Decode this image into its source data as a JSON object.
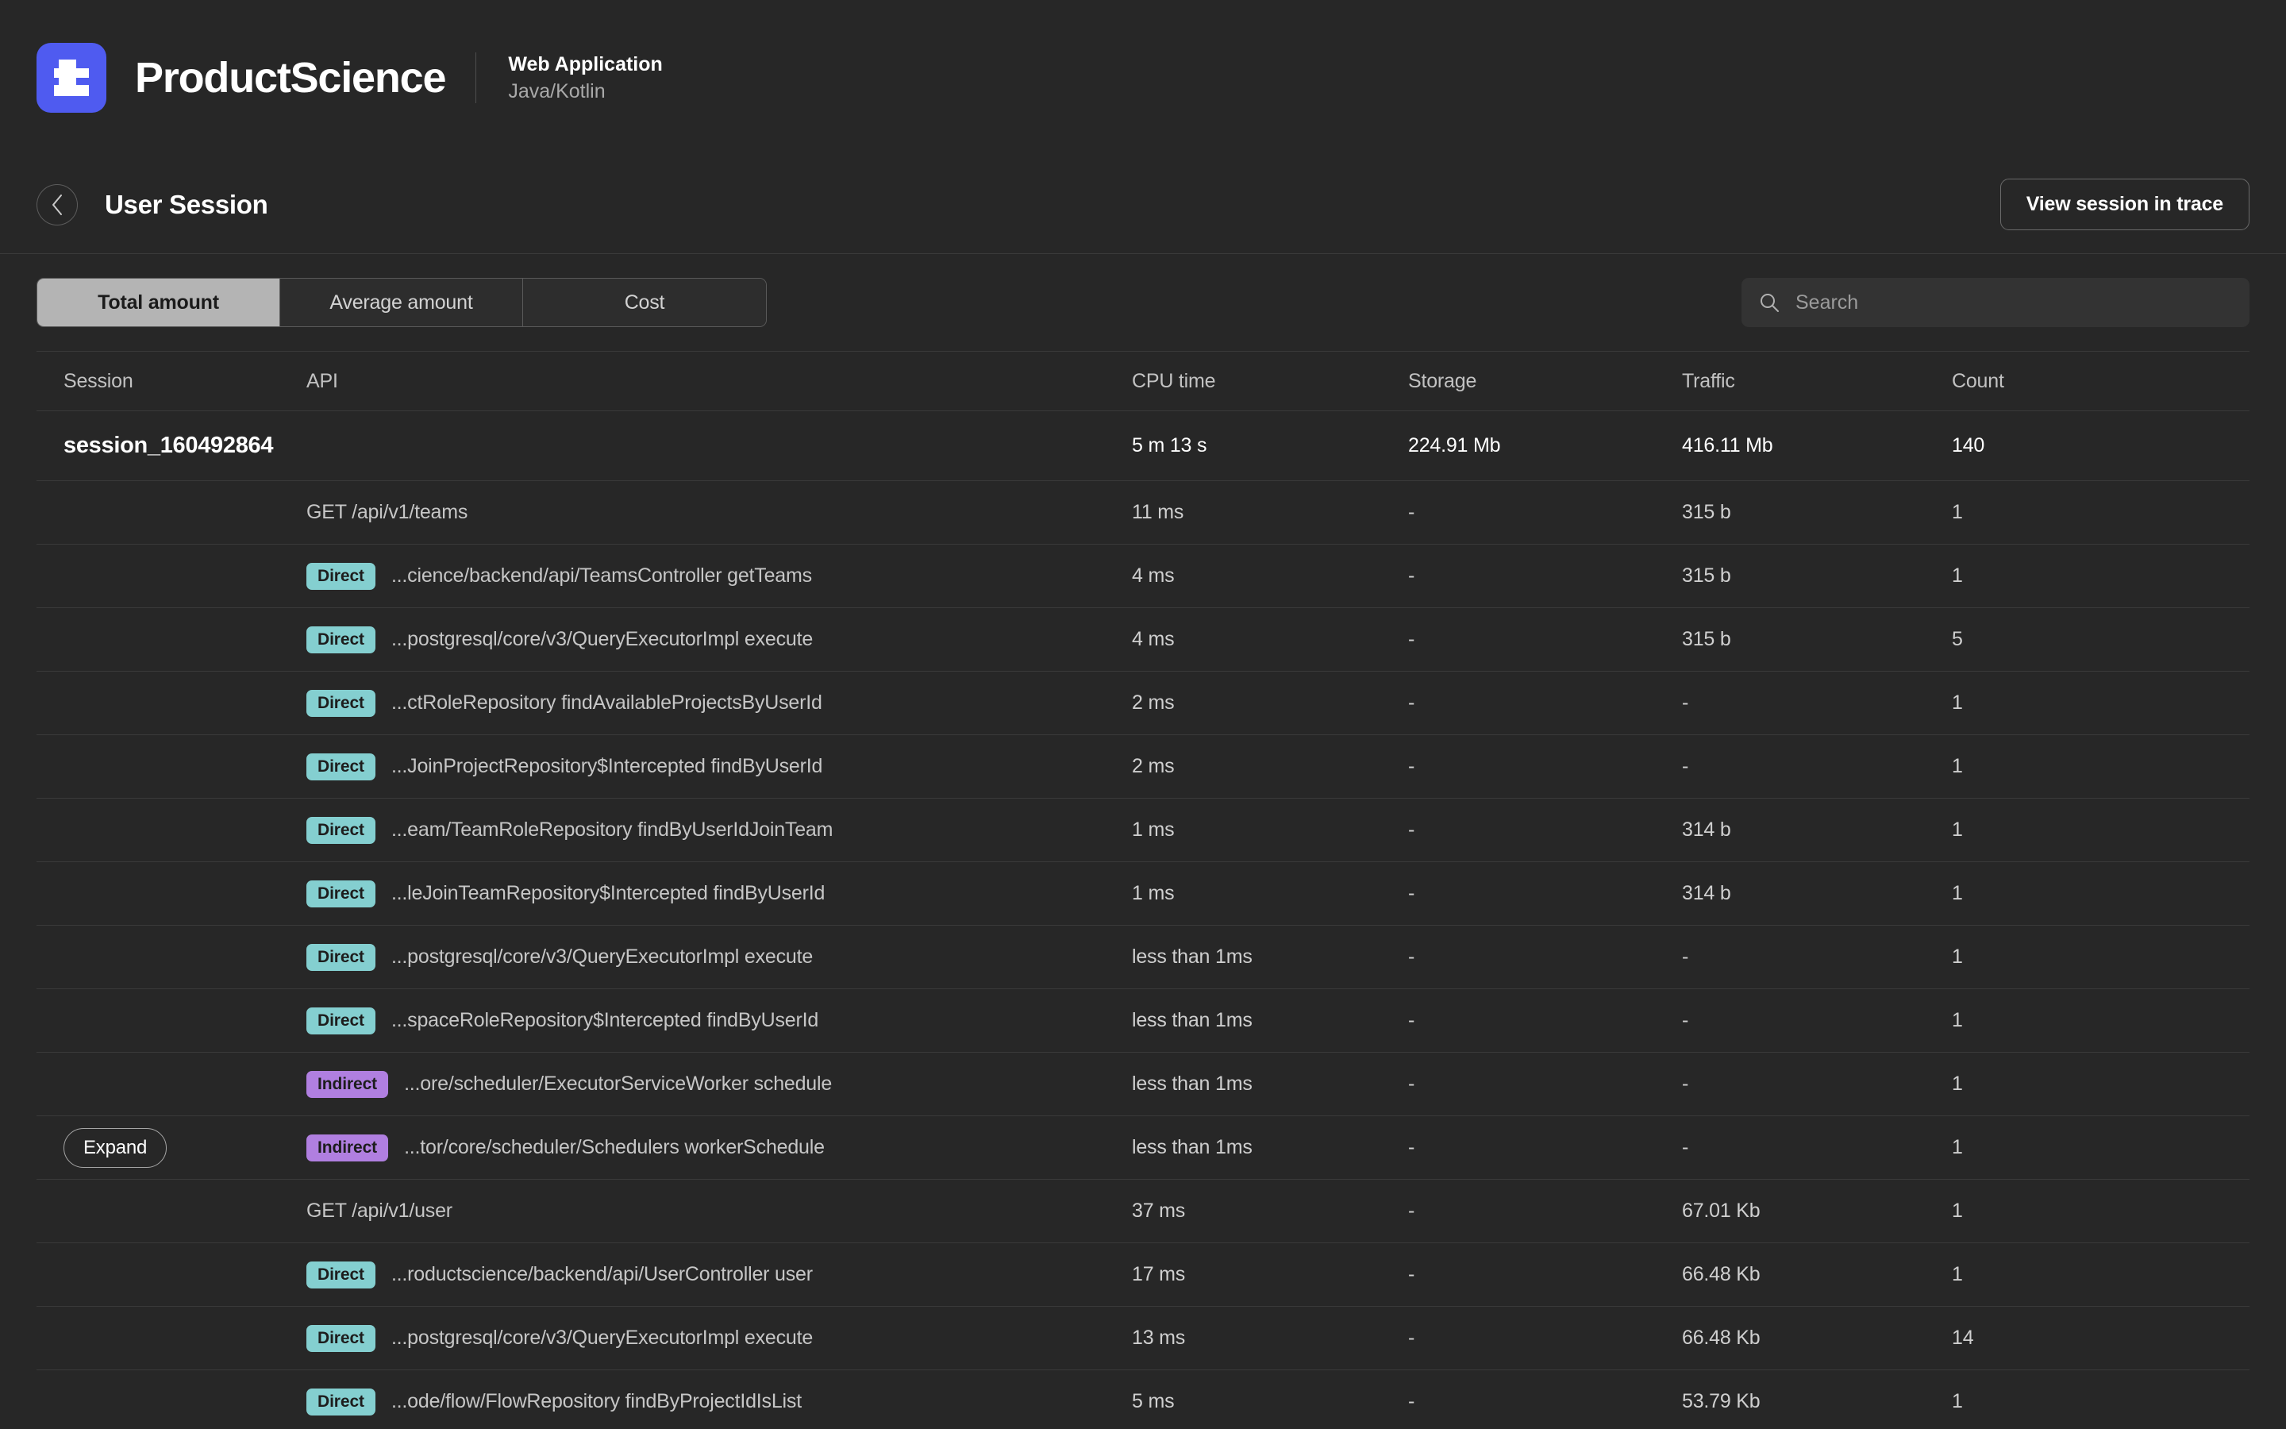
{
  "brand": {
    "logo_icon": "productscience-logo-icon",
    "name": "ProductScience",
    "app_title": "Web Application",
    "app_subtitle": "Java/Kotlin"
  },
  "header": {
    "back_icon": "chevron-left-icon",
    "title": "User Session",
    "trace_button": "View session in trace"
  },
  "toolbar": {
    "tabs": [
      {
        "label": "Total amount",
        "active": true
      },
      {
        "label": "Average amount",
        "active": false
      },
      {
        "label": "Cost",
        "active": false
      }
    ],
    "search": {
      "icon": "search-icon",
      "placeholder": "Search",
      "value": ""
    }
  },
  "table": {
    "columns": [
      "Session",
      "API",
      "CPU time",
      "Storage",
      "Traffic",
      "Count"
    ],
    "expand_label": "Expand",
    "rows": [
      {
        "kind": "session",
        "session": "session_160492864",
        "api": "",
        "cpu": "5 m 13 s",
        "storage": "224.91 Mb",
        "traffic": "416.11 Mb",
        "count": "140"
      },
      {
        "kind": "api",
        "session": "",
        "api": "GET /api/v1/teams",
        "cpu": "11 ms",
        "storage": "-",
        "traffic": "315 b",
        "count": "1"
      },
      {
        "kind": "call",
        "badge": "Direct",
        "api": "...cience/backend/api/TeamsController getTeams",
        "cpu": "4 ms",
        "storage": "-",
        "traffic": "315 b",
        "count": "1"
      },
      {
        "kind": "call",
        "badge": "Direct",
        "api": "...postgresql/core/v3/QueryExecutorImpl execute",
        "cpu": "4 ms",
        "storage": "-",
        "traffic": "315 b",
        "count": "5"
      },
      {
        "kind": "call",
        "badge": "Direct",
        "api": "...ctRoleRepository findAvailableProjectsByUserId",
        "cpu": "2 ms",
        "storage": "-",
        "traffic": "-",
        "count": "1"
      },
      {
        "kind": "call",
        "badge": "Direct",
        "api": "...JoinProjectRepository$Intercepted findByUserId",
        "cpu": "2 ms",
        "storage": "-",
        "traffic": "-",
        "count": "1"
      },
      {
        "kind": "call",
        "badge": "Direct",
        "api": "...eam/TeamRoleRepository findByUserIdJoinTeam",
        "cpu": "1 ms",
        "storage": "-",
        "traffic": "314 b",
        "count": "1"
      },
      {
        "kind": "call",
        "badge": "Direct",
        "api": "...leJoinTeamRepository$Intercepted findByUserId",
        "cpu": "1 ms",
        "storage": "-",
        "traffic": "314 b",
        "count": "1"
      },
      {
        "kind": "call",
        "badge": "Direct",
        "api": "...postgresql/core/v3/QueryExecutorImpl execute",
        "cpu": "less than 1ms",
        "storage": "-",
        "traffic": "-",
        "count": "1"
      },
      {
        "kind": "call",
        "badge": "Direct",
        "api": "...spaceRoleRepository$Intercepted findByUserId",
        "cpu": "less than 1ms",
        "storage": "-",
        "traffic": "-",
        "count": "1"
      },
      {
        "kind": "call",
        "badge": "Indirect",
        "api": "...ore/scheduler/ExecutorServiceWorker schedule",
        "cpu": "less than 1ms",
        "storage": "-",
        "traffic": "-",
        "count": "1"
      },
      {
        "kind": "call",
        "badge": "Indirect",
        "expand": true,
        "api": "...tor/core/scheduler/Schedulers workerSchedule",
        "cpu": "less than 1ms",
        "storage": "-",
        "traffic": "-",
        "count": "1"
      },
      {
        "kind": "api",
        "session": "",
        "api": "GET /api/v1/user",
        "cpu": "37 ms",
        "storage": "-",
        "traffic": "67.01 Kb",
        "count": "1"
      },
      {
        "kind": "call",
        "badge": "Direct",
        "api": "...roductscience/backend/api/UserController user",
        "cpu": "17 ms",
        "storage": "-",
        "traffic": "66.48 Kb",
        "count": "1"
      },
      {
        "kind": "call",
        "badge": "Direct",
        "api": "...postgresql/core/v3/QueryExecutorImpl execute",
        "cpu": "13 ms",
        "storage": "-",
        "traffic": "66.48 Kb",
        "count": "14"
      },
      {
        "kind": "call",
        "badge": "Direct",
        "api": "...ode/flow/FlowRepository findByProjectIdIsList",
        "cpu": "5 ms",
        "storage": "-",
        "traffic": "53.79 Kb",
        "count": "1"
      }
    ]
  },
  "colors": {
    "background": "#272727",
    "brand_accent": "#4f5bf0",
    "badge_direct": "#84cfd0",
    "badge_indirect": "#b07fe0",
    "tab_active_bg": "#b4b4b4"
  }
}
